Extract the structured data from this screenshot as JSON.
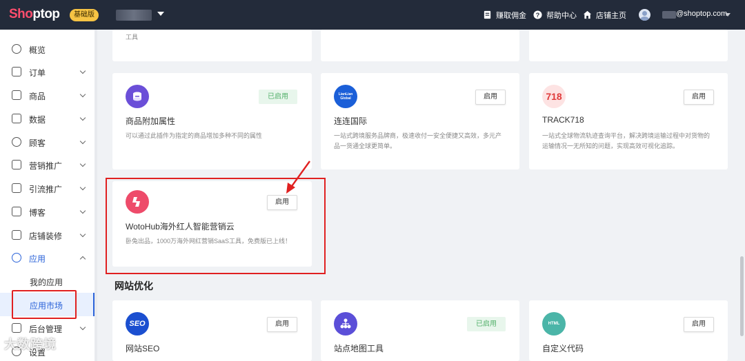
{
  "topbar": {
    "logo_part1": "Sho",
    "logo_part2": "ptop",
    "edition": "基础版",
    "earn_commission": "赚取佣金",
    "help_center": "帮助中心",
    "store_home": "店铺主页",
    "email": "@shoptop.com"
  },
  "sidebar": {
    "items": [
      {
        "label": "概览"
      },
      {
        "label": "订单"
      },
      {
        "label": "商品"
      },
      {
        "label": "数据"
      },
      {
        "label": "顾客"
      },
      {
        "label": "营销推广"
      },
      {
        "label": "引流推广"
      },
      {
        "label": "博客"
      },
      {
        "label": "店铺装修"
      },
      {
        "label": "应用"
      },
      {
        "label": "后台管理"
      },
      {
        "label": "设置"
      }
    ],
    "subitems": [
      {
        "label": "我的应用"
      },
      {
        "label": "应用市场"
      }
    ]
  },
  "main": {
    "partial_top_desc": "工具",
    "cards": [
      {
        "title": "商品附加属性",
        "desc": "可以通过此插件为指定的商品增加多种不同的属性",
        "status": "已启用"
      },
      {
        "title": "连连国际",
        "desc": "一站式跨境服务品牌商，极速收付一安全便捷又高效，多元产品一货通全球更简单。",
        "status": "启用",
        "icon_text": "LianLian Global"
      },
      {
        "title": "TRACK718",
        "desc": "一站式全球物流轨迹查询平台，解决跨境运输过程中对货物的运输情况一无所知的问题，实现高效可视化追踪。",
        "status": "启用",
        "icon_text": "718"
      },
      {
        "title": "WotoHub海外红人智能营销云",
        "desc": "卧兔出品，1000万海外网红营销SaaS工具，免费版已上线！",
        "status": "启用"
      },
      {
        "title": "网站SEO",
        "status": "启用",
        "icon_text": "SEO"
      },
      {
        "title": "站点地图工具",
        "status": "已启用"
      },
      {
        "title": "自定义代码",
        "status": "启用",
        "icon_text": "HTML"
      }
    ],
    "section_title": "网站优化"
  },
  "watermark": "大数跨境",
  "colors": {
    "topbar_bg": "#232b3a",
    "accent": "#2b63d9",
    "highlight_red": "#e02020",
    "enabled_green": "#52b06a"
  }
}
